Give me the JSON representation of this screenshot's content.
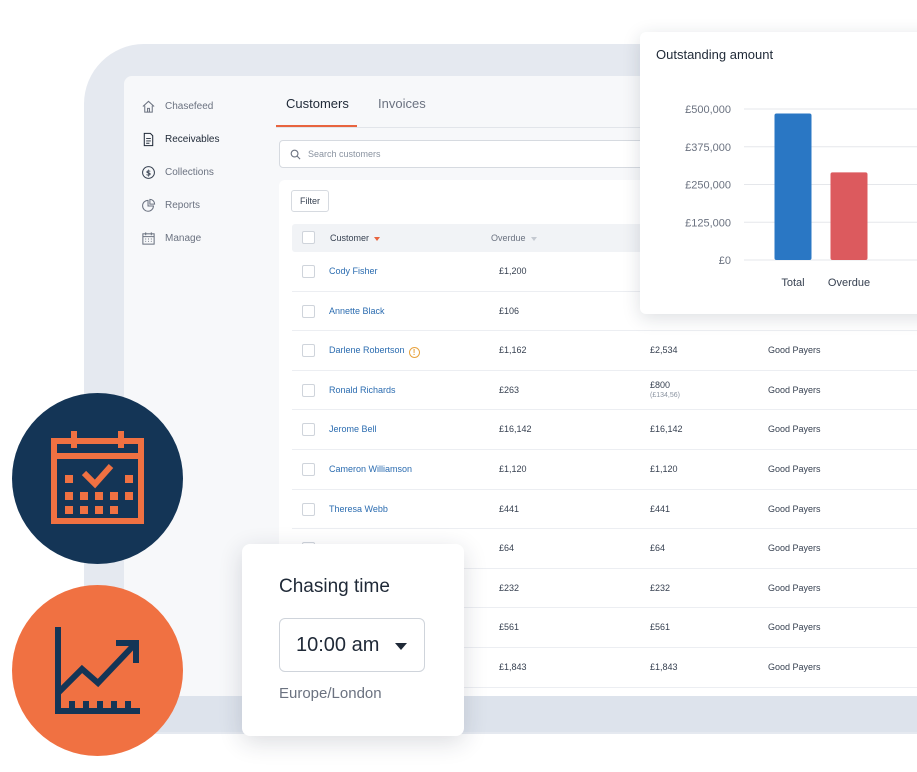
{
  "sidebar": {
    "items": [
      {
        "label": "Chasefeed",
        "icon": "home-icon"
      },
      {
        "label": "Receivables",
        "icon": "document-icon"
      },
      {
        "label": "Collections",
        "icon": "dollar-circle-icon"
      },
      {
        "label": "Reports",
        "icon": "pie-chart-icon"
      },
      {
        "label": "Manage",
        "icon": "calendar-icon"
      }
    ]
  },
  "tabs": [
    {
      "label": "Customers"
    },
    {
      "label": "Invoices"
    }
  ],
  "search": {
    "placeholder": "Search customers"
  },
  "table": {
    "filter_label": "Filter",
    "headers": {
      "customer": "Customer",
      "overdue": "Overdue"
    },
    "rows": [
      {
        "name": "Cody Fisher",
        "overdue": "£1,200",
        "total": "",
        "total_sub": "",
        "group": "",
        "warning": false
      },
      {
        "name": "Annette Black",
        "overdue": "£106",
        "total": "",
        "total_sub": "",
        "group": "",
        "warning": false
      },
      {
        "name": "Darlene Robertson",
        "overdue": "£1,162",
        "total": "£2,534",
        "total_sub": "",
        "group": "Good Payers",
        "warning": true
      },
      {
        "name": "Ronald Richards",
        "overdue": "£263",
        "total": "£800",
        "total_sub": "(£134,56)",
        "group": "Good Payers",
        "warning": false
      },
      {
        "name": "Jerome Bell",
        "overdue": "£16,142",
        "total": "£16,142",
        "total_sub": "",
        "group": "Good Payers",
        "warning": false
      },
      {
        "name": "Cameron Williamson",
        "overdue": "£1,120",
        "total": "£1,120",
        "total_sub": "",
        "group": "Good Payers",
        "warning": false
      },
      {
        "name": "Theresa Webb",
        "overdue": "£441",
        "total": "£441",
        "total_sub": "",
        "group": "Good Payers",
        "warning": false
      },
      {
        "name": "",
        "overdue": "£64",
        "total": "£64",
        "total_sub": "",
        "group": "Good Payers",
        "warning": false
      },
      {
        "name": "",
        "overdue": "£232",
        "total": "£232",
        "total_sub": "",
        "group": "Good Payers",
        "warning": false
      },
      {
        "name": "",
        "overdue": "£561",
        "total": "£561",
        "total_sub": "",
        "group": "Good Payers",
        "warning": false
      },
      {
        "name": "",
        "overdue": "£1,843",
        "total": "£1,843",
        "total_sub": "",
        "group": "Good Payers",
        "warning": false
      }
    ]
  },
  "chart_data": {
    "type": "bar",
    "title": "Outstanding amount",
    "categories": [
      "Total",
      "Overdue"
    ],
    "values": [
      485000,
      290000
    ],
    "colors": [
      "#2a77c4",
      "#dc5a5e"
    ],
    "ylim": [
      0,
      500000
    ],
    "yticks": [
      "£0",
      "£125,000",
      "£250,000",
      "£375,000",
      "£500,000"
    ],
    "ytick_values": [
      0,
      125000,
      250000,
      375000,
      500000
    ],
    "grid": true
  },
  "chasing": {
    "title": "Chasing time",
    "time": "10:00 am",
    "timezone": "Europe/London"
  },
  "badges": [
    {
      "icon": "calendar-check-icon",
      "color": "#143556"
    },
    {
      "icon": "trend-up-chart-icon",
      "color": "#f07142"
    }
  ],
  "colors": {
    "accent": "#e8643f",
    "link": "#2b6cb0",
    "navy": "#143556",
    "orange": "#f07142"
  }
}
